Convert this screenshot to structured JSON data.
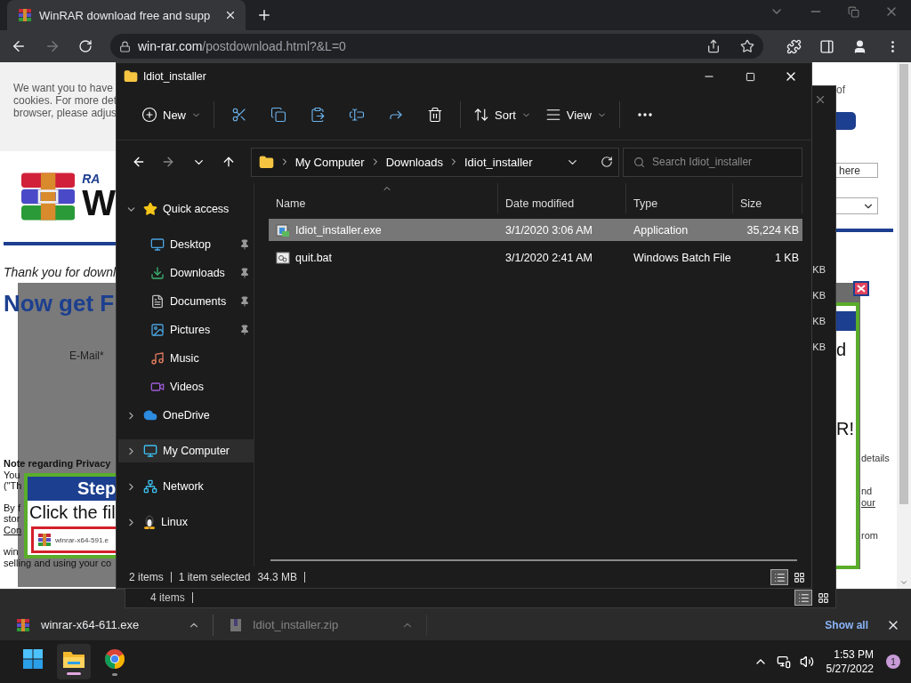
{
  "browser": {
    "tab": {
      "title": "WinRAR download free and supp",
      "selected": true
    },
    "url": {
      "host": "win-rar.com",
      "path": "/postdownload.html?&L=0"
    }
  },
  "web_page": {
    "cookie_notice": [
      "We want you to have",
      "cookies. For more det",
      "browser, please adjus"
    ],
    "logo_text": [
      "RA",
      "W"
    ],
    "thanks": "Thank you for downl",
    "heading": "Now get F",
    "email_label": "E-Mail*",
    "notes": [
      {
        "text": "Note regarding Privacy",
        "kind": "bold"
      },
      {
        "text": "You",
        "kind": "plain"
      },
      {
        "text": "(\"Th",
        "kind": "plain"
      },
      {
        "text": "By f",
        "kind": "gap"
      },
      {
        "text": "stor",
        "kind": "plain"
      },
      {
        "text": "Con",
        "kind": "link"
      },
      {
        "text": "win",
        "kind": "gap"
      },
      {
        "text": "selling and using your co",
        "kind": "plain"
      }
    ],
    "popup": {
      "step": "Step",
      "instruction": "Click the fil",
      "file": "winrar-x64-591.e"
    },
    "right": {
      "notice_end": "of",
      "field": "here",
      "popup_texts": [
        "d",
        "R!"
      ],
      "lines": [
        {
          "text": "details",
          "kind": "plain"
        },
        {
          "text": "nd",
          "kind": "gap"
        },
        {
          "text": "our",
          "kind": "link"
        },
        {
          "text": "rom",
          "kind": "gap"
        }
      ]
    }
  },
  "back_window": {
    "sizes": [
      "KB",
      "KB",
      "KB",
      "KB"
    ],
    "status": "4 items",
    "views": [
      {
        "kind": "details",
        "selected": true
      },
      {
        "kind": "tiles",
        "selected": false
      }
    ]
  },
  "explorer": {
    "title": "Idiot_installer",
    "toolbar": [
      [
        {
          "kind": "new",
          "label": "New"
        }
      ],
      [
        {
          "kind": "cut"
        },
        {
          "kind": "copy"
        },
        {
          "kind": "paste"
        },
        {
          "kind": "rename"
        },
        {
          "kind": "share"
        },
        {
          "kind": "delete"
        }
      ],
      [
        {
          "kind": "sort",
          "label": "Sort"
        },
        {
          "kind": "view",
          "label": "View"
        }
      ],
      [
        {
          "kind": "more"
        }
      ]
    ],
    "breadcrumb": [
      "My Computer",
      "Downloads",
      "Idiot_installer"
    ],
    "search": {
      "placeholder": "Search Idiot_installer"
    },
    "nav": [
      {
        "label": "Quick access",
        "kind": "quick",
        "expanded": true,
        "selected": false,
        "children": [
          {
            "label": "Desktop",
            "kind": "desktop",
            "pinned": true,
            "selected": false
          },
          {
            "label": "Downloads",
            "kind": "downloads",
            "pinned": true,
            "selected": false
          },
          {
            "label": "Documents",
            "kind": "documents",
            "pinned": true,
            "selected": false
          },
          {
            "label": "Pictures",
            "kind": "pictures",
            "pinned": true,
            "selected": false
          },
          {
            "label": "Music",
            "kind": "music",
            "pinned": false,
            "selected": false
          },
          {
            "label": "Videos",
            "kind": "videos",
            "pinned": false,
            "selected": false
          }
        ]
      },
      {
        "label": "OneDrive",
        "kind": "onedrive",
        "expanded": false,
        "selected": false
      },
      {
        "label": "My Computer",
        "kind": "computer",
        "expanded": false,
        "selected": true
      },
      {
        "label": "Network",
        "kind": "network",
        "expanded": false,
        "selected": false
      },
      {
        "label": "Linux",
        "kind": "linux",
        "expanded": false,
        "selected": false
      }
    ],
    "columns": [
      {
        "label": "Name",
        "sorted": true
      },
      {
        "label": "Date modified",
        "sorted": false
      },
      {
        "label": "Type",
        "sorted": false
      },
      {
        "label": "Size",
        "sorted": false
      }
    ],
    "files": [
      {
        "name": "Idiot_installer.exe",
        "kind": "exe",
        "date": "3/1/2020 3:06 AM",
        "type": "Application",
        "size": "35,224 KB",
        "selected": true
      },
      {
        "name": "quit.bat",
        "kind": "bat",
        "date": "3/1/2020 2:41 AM",
        "type": "Windows Batch File",
        "size": "1 KB",
        "selected": false
      }
    ],
    "status": {
      "count": "2 items",
      "selection": "1 item selected",
      "size": "34.3 MB"
    },
    "views": [
      {
        "kind": "details",
        "selected": true
      },
      {
        "kind": "tiles",
        "selected": false
      }
    ]
  },
  "downloads_bar": {
    "items": [
      {
        "name": "winrar-x64-611.exe",
        "kind": "winrar",
        "dimmed": false
      },
      {
        "name": "Idiot_installer.zip",
        "kind": "zip",
        "dimmed": true
      }
    ],
    "show_all": "Show all"
  },
  "taskbar": {
    "apps": [
      {
        "kind": "start",
        "running": false,
        "active": false
      },
      {
        "kind": "explorer",
        "running": true,
        "active": true
      },
      {
        "kind": "chrome",
        "running": true,
        "active": false
      }
    ],
    "time": "1:53 PM",
    "date": "5/27/2022",
    "notifications": "1"
  }
}
